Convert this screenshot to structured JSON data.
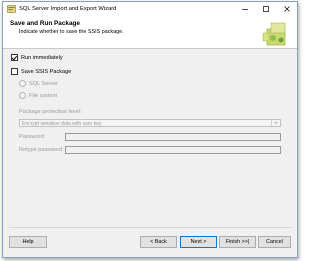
{
  "window": {
    "title": "SQL Server Import and Export Wizard"
  },
  "header": {
    "title": "Save and Run Package",
    "subtitle": "Indicate whether to save the SSIS package."
  },
  "options": {
    "run_immediately": {
      "label": "Run immediately",
      "checked": true
    },
    "save_ssis_package": {
      "label": "Save SSIS Package",
      "checked": false
    },
    "sql_server": {
      "label": "SQL Server",
      "selected": true,
      "enabled": false
    },
    "file_system": {
      "label": "File system",
      "selected": false,
      "enabled": false
    }
  },
  "protection": {
    "label": "Package protection level:",
    "value": "Encrypt sensitive data with user key"
  },
  "password": {
    "label": "Password:",
    "value": ""
  },
  "retype_password": {
    "label": "Retype password:",
    "value": ""
  },
  "buttons": {
    "help": "Help",
    "back": "< Back",
    "next": "Next >",
    "finish": "Finish >>|",
    "cancel": "Cancel"
  },
  "colors": {
    "window_border": "#8aa0c0",
    "dialog_bg": "#f0f0f0",
    "default_button_border": "#0078d7",
    "disabled_text": "#9a9a9a"
  },
  "icons": {
    "app": "sql-wizard-icon",
    "minimize": "minimize-icon",
    "maximize": "maximize-icon",
    "close": "close-icon",
    "header_graphic": "package-wizard-graphic"
  }
}
